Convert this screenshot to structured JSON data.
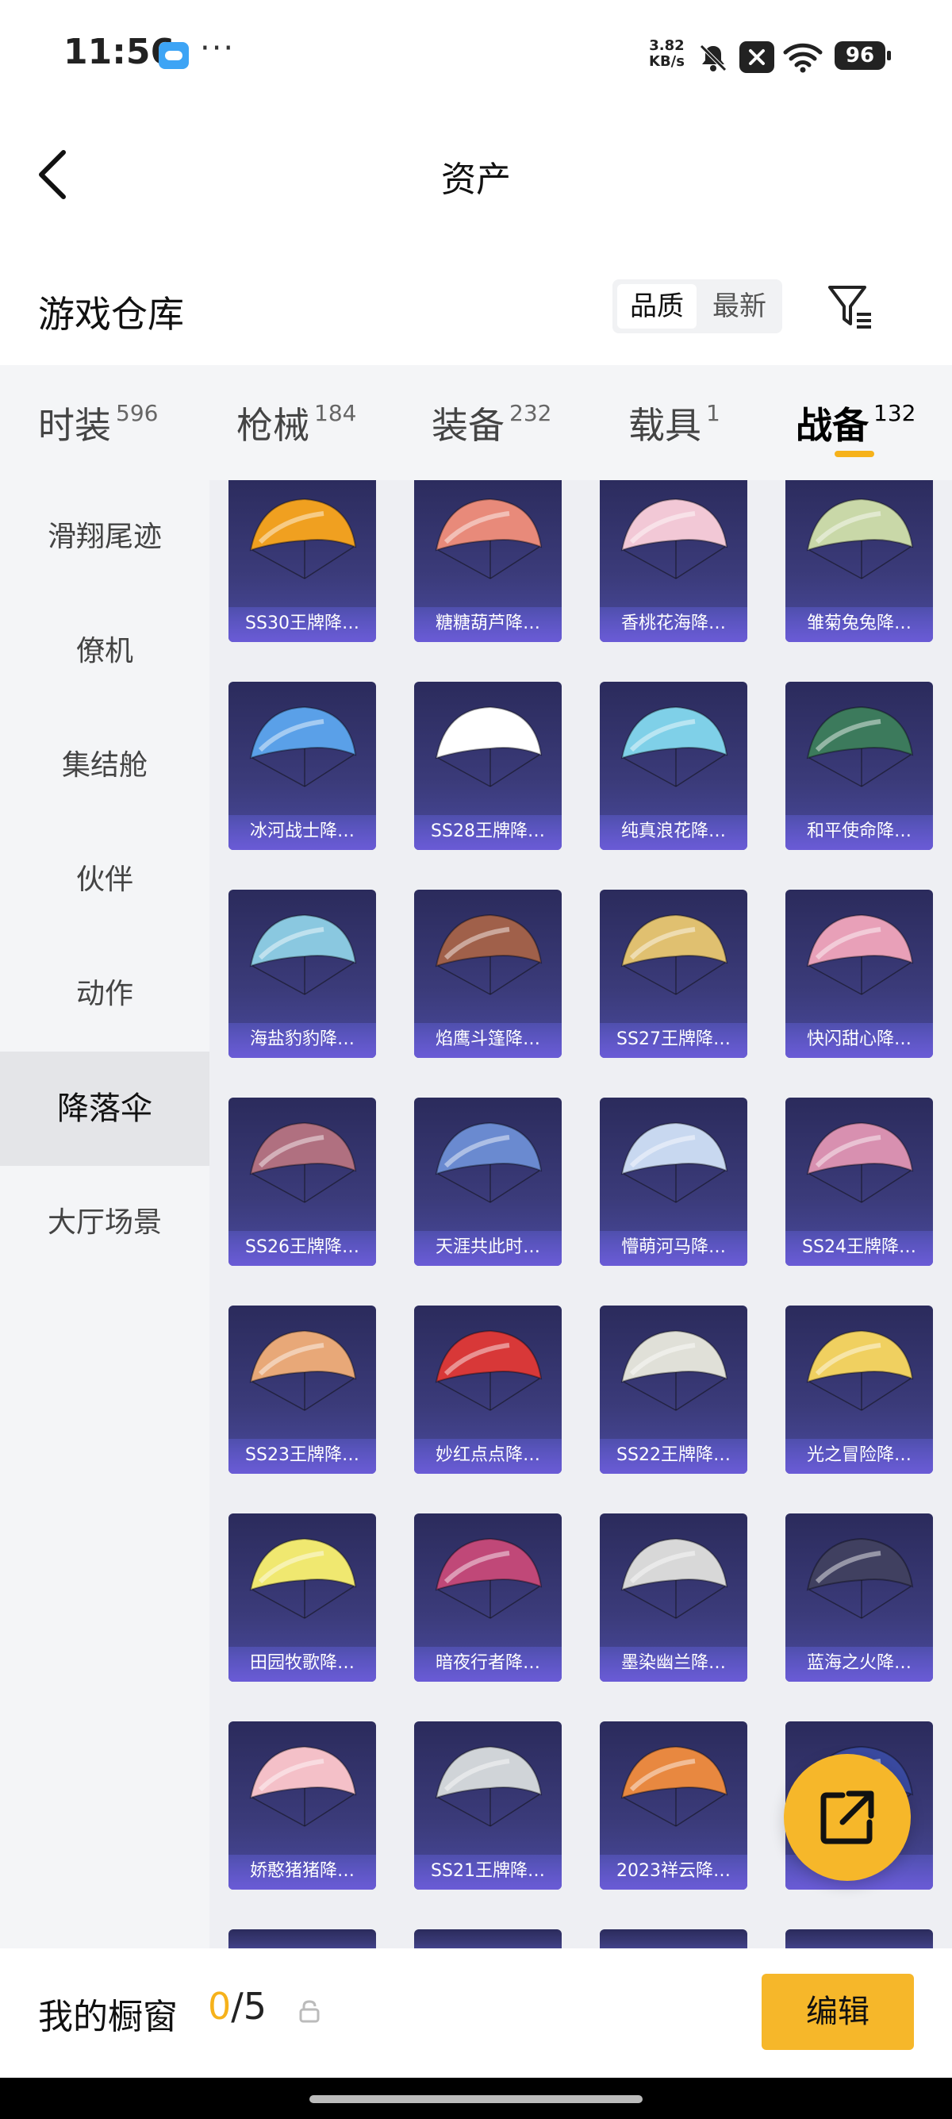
{
  "status_bar": {
    "time": "11:56",
    "more": "···",
    "net_speed": "3.82",
    "net_unit": "KB/s",
    "battery": "96"
  },
  "header": {
    "title": "资产"
  },
  "section": {
    "title": "游戏仓库",
    "sort_quality": "品质",
    "sort_latest": "最新"
  },
  "tabs": [
    {
      "label": "时装",
      "count": "596"
    },
    {
      "label": "枪械",
      "count": "184"
    },
    {
      "label": "装备",
      "count": "232"
    },
    {
      "label": "载具",
      "count": "1"
    },
    {
      "label": "战备",
      "count": "132"
    }
  ],
  "sidebar": [
    {
      "label": "滑翔尾迹"
    },
    {
      "label": "僚机"
    },
    {
      "label": "集结舱"
    },
    {
      "label": "伙伴"
    },
    {
      "label": "动作"
    },
    {
      "label": "降落伞"
    },
    {
      "label": "大厅场景"
    }
  ],
  "items": [
    {
      "label": "SS30王牌降…",
      "color": "#f0a020"
    },
    {
      "label": "糖糖葫芦降…",
      "color": "#e88a7a"
    },
    {
      "label": "香桃花海降…",
      "color": "#f2c8d6"
    },
    {
      "label": "雏菊兔兔降…",
      "color": "#c9d8a8"
    },
    {
      "label": "冰河战士降…",
      "color": "#5aa0e8"
    },
    {
      "label": "SS28王牌降…",
      "color": "#ffffff"
    },
    {
      "label": "纯真浪花降…",
      "color": "#7fd0e8"
    },
    {
      "label": "和平使命降…",
      "color": "#3c7a5c"
    },
    {
      "label": "海盐豹豹降…",
      "color": "#8ac8e0"
    },
    {
      "label": "焰鹰斗篷降…",
      "color": "#a0604a"
    },
    {
      "label": "SS27王牌降…",
      "color": "#e0c070"
    },
    {
      "label": "快闪甜心降…",
      "color": "#e8a0b8"
    },
    {
      "label": "SS26王牌降…",
      "color": "#b07080"
    },
    {
      "label": "天涯共此时…",
      "color": "#6a8ad0"
    },
    {
      "label": "懵萌河马降…",
      "color": "#c8d8f0"
    },
    {
      "label": "SS24王牌降…",
      "color": "#d890b0"
    },
    {
      "label": "SS23王牌降…",
      "color": "#e8a878"
    },
    {
      "label": "妙红点点降…",
      "color": "#d83838"
    },
    {
      "label": "SS22王牌降…",
      "color": "#e0e0d8"
    },
    {
      "label": "光之冒险降…",
      "color": "#f0d060"
    },
    {
      "label": "田园牧歌降…",
      "color": "#f0e870"
    },
    {
      "label": "暗夜行者降…",
      "color": "#c04878"
    },
    {
      "label": "墨染幽兰降…",
      "color": "#d8d8d8"
    },
    {
      "label": "蓝海之火降…",
      "color": "#404060"
    },
    {
      "label": "娇憨猪猪降…",
      "color": "#f4c0c8"
    },
    {
      "label": "SS21王牌降…",
      "color": "#d0d4d8"
    },
    {
      "label": "2023祥云降…",
      "color": "#e88840"
    },
    {
      "label": "",
      "color": "#3a4aa0"
    }
  ],
  "bottom_bar": {
    "label": "我的橱窗",
    "current": "0",
    "total": "/5",
    "edit": "编辑"
  }
}
